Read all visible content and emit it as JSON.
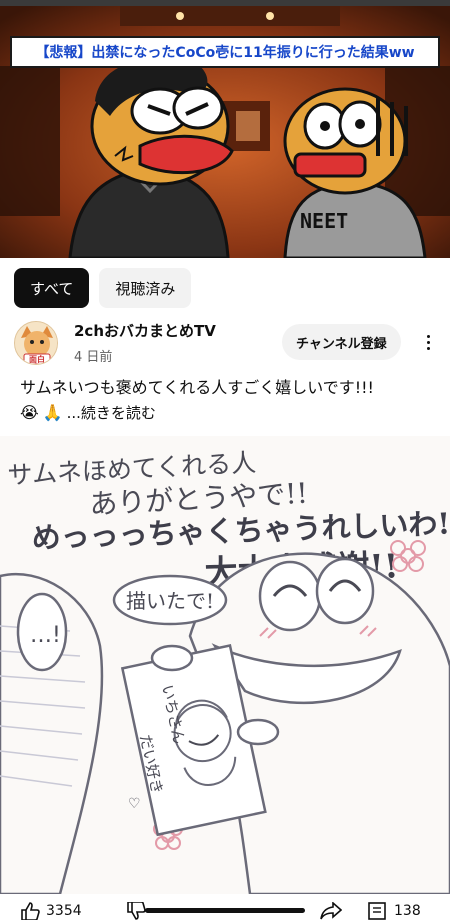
{
  "thumbnail": {
    "title": "【悲報】出禁になったCoCo壱に11年振りに行った結果ww",
    "shirt_text": "NEET"
  },
  "filters": [
    {
      "label": "すべて",
      "active": true
    },
    {
      "label": "視聴済み",
      "active": false
    }
  ],
  "post": {
    "avatar_text": "面白",
    "channel": "2chおバカまとめTV",
    "time": "4 日前",
    "subscribe_label": "チャンネル登録",
    "text": "サムネいつも褒めてくれる人すごく嬉しいです!!!",
    "emojis": [
      "😭",
      "🙏"
    ],
    "read_more": "...続きを読む"
  },
  "illustration": {
    "line1": "サムネほめてくれる人",
    "line2": "ありがとうやで!!",
    "line3": "めっっっちゃくちゃうれしいわ!!",
    "line4": "大大大感謝!!",
    "speech_left": "…!",
    "speech_right": "描いたで!",
    "card_text1": "いちさん",
    "card_text2": "だい好き",
    "card_heart": "♡"
  },
  "actions": {
    "likes": "3354",
    "comments": "138"
  }
}
